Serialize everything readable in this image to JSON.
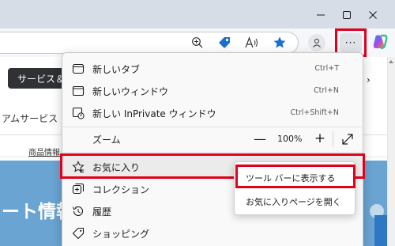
{
  "page": {
    "service_pill_text": "サービス＆",
    "service_text": "アムサービス",
    "product_text": "商品情報",
    "banner_text": "ート情報",
    "arrow_fragment": "›"
  },
  "menu": {
    "items": [
      {
        "label": "新しいタブ",
        "shortcut": "Ctrl+T",
        "icon": "new-tab-icon"
      },
      {
        "label": "新しいウィンドウ",
        "shortcut": "Ctrl+N",
        "icon": "new-window-icon"
      },
      {
        "label": "新しい InPrivate ウィンドウ",
        "shortcut": "Ctrl+Shift+N",
        "icon": "inprivate-icon"
      }
    ],
    "zoom": {
      "label": "ズーム",
      "minus": "—",
      "value": "100%",
      "plus": "+"
    },
    "favorites": {
      "label": "お気に入り",
      "chevron": "›",
      "icon": "favorites-star-icon"
    },
    "collections": {
      "label": "コレクション",
      "icon": "collections-icon"
    },
    "history": {
      "label": "履歴",
      "icon": "history-icon"
    },
    "shopping": {
      "label": "ショッピング",
      "icon": "shopping-tag-icon"
    }
  },
  "submenu": {
    "items": [
      {
        "label": "ツール バーに表示する"
      },
      {
        "label": "お気に入りページを開く"
      }
    ]
  },
  "toolbar": {
    "more_label": "···"
  },
  "colors": {
    "highlight": "#e0001b",
    "titlebar": "#d6dde6",
    "banner": "#6aa4d3"
  }
}
